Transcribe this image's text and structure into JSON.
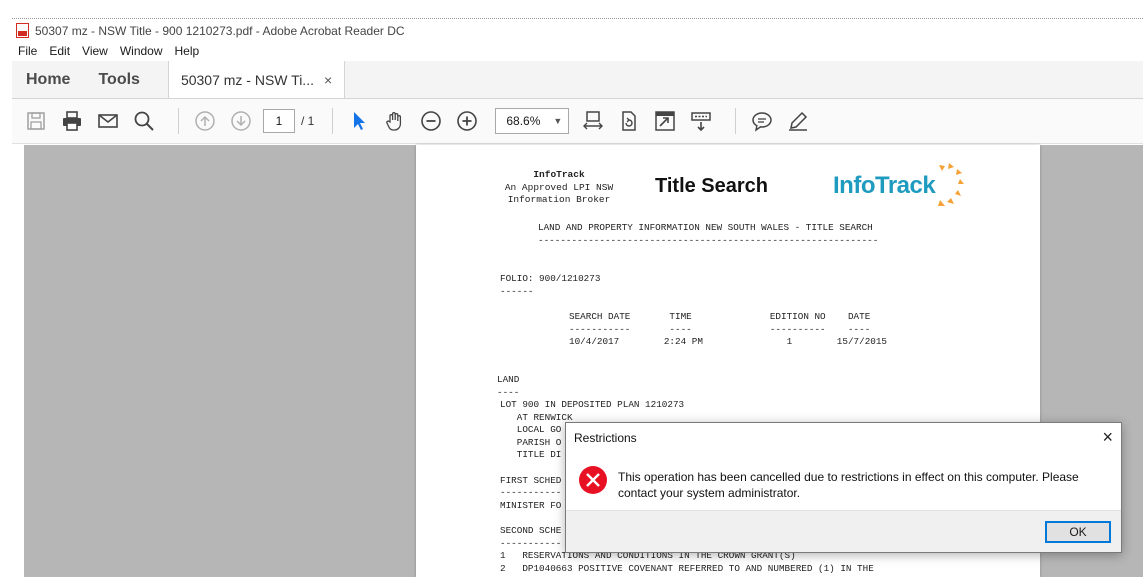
{
  "window": {
    "title": "50307 mz - NSW Title - 900 1210273.pdf - Adobe Acrobat Reader DC"
  },
  "menu": [
    "File",
    "Edit",
    "View",
    "Window",
    "Help"
  ],
  "tabs": {
    "home": "Home",
    "tools": "Tools",
    "document": "50307 mz - NSW Ti...",
    "close": "×"
  },
  "toolbar": {
    "page_current": "1",
    "page_total": "/ 1",
    "zoom": "68.6%"
  },
  "document": {
    "brand_name": "InfoTrack",
    "brand_line2": "An Approved LPI NSW",
    "brand_line3": "Information Broker",
    "title": "Title Search",
    "logo_text": "InfoTrack",
    "header_line": "LAND AND PROPERTY INFORMATION NEW SOUTH WALES - TITLE SEARCH",
    "header_rule": "-------------------------------------------------------------",
    "folio_label": "FOLIO: 900/1210273",
    "folio_rule": "------",
    "cols_header": "SEARCH DATE       TIME              EDITION NO    DATE",
    "cols_rule": "-----------       ----              ----------    ----",
    "cols_values": "10/4/2017        2:24 PM               1        15/7/2015",
    "land_label": "LAND",
    "land_rule": "----",
    "land_1": "LOT 900 IN DEPOSITED PLAN 1210273",
    "land_2": "   AT RENWICK",
    "land_3": "   LOCAL GO",
    "land_4": "   PARISH O",
    "land_5": "   TITLE DI",
    "first_sched": "FIRST SCHED",
    "first_rule": "-----------",
    "minister": "MINISTER FO",
    "second_sched": "SECOND SCHE",
    "second_rule": "-----------",
    "item_1": "1   RESERVATIONS AND CONDITIONS IN THE CROWN GRANT(S)",
    "item_2": "2   DP1040663 POSITIVE COVENANT REFERRED TO AND NUMBERED (1) IN THE"
  },
  "dialog": {
    "title": "Restrictions",
    "message": "This operation has been cancelled due to restrictions in effect on this computer. Please contact your system administrator.",
    "ok_label": "OK",
    "close": "×"
  },
  "colors": {
    "accent": "#1f9bbf",
    "error": "#e81123",
    "logo_orange": "#f4a235"
  }
}
